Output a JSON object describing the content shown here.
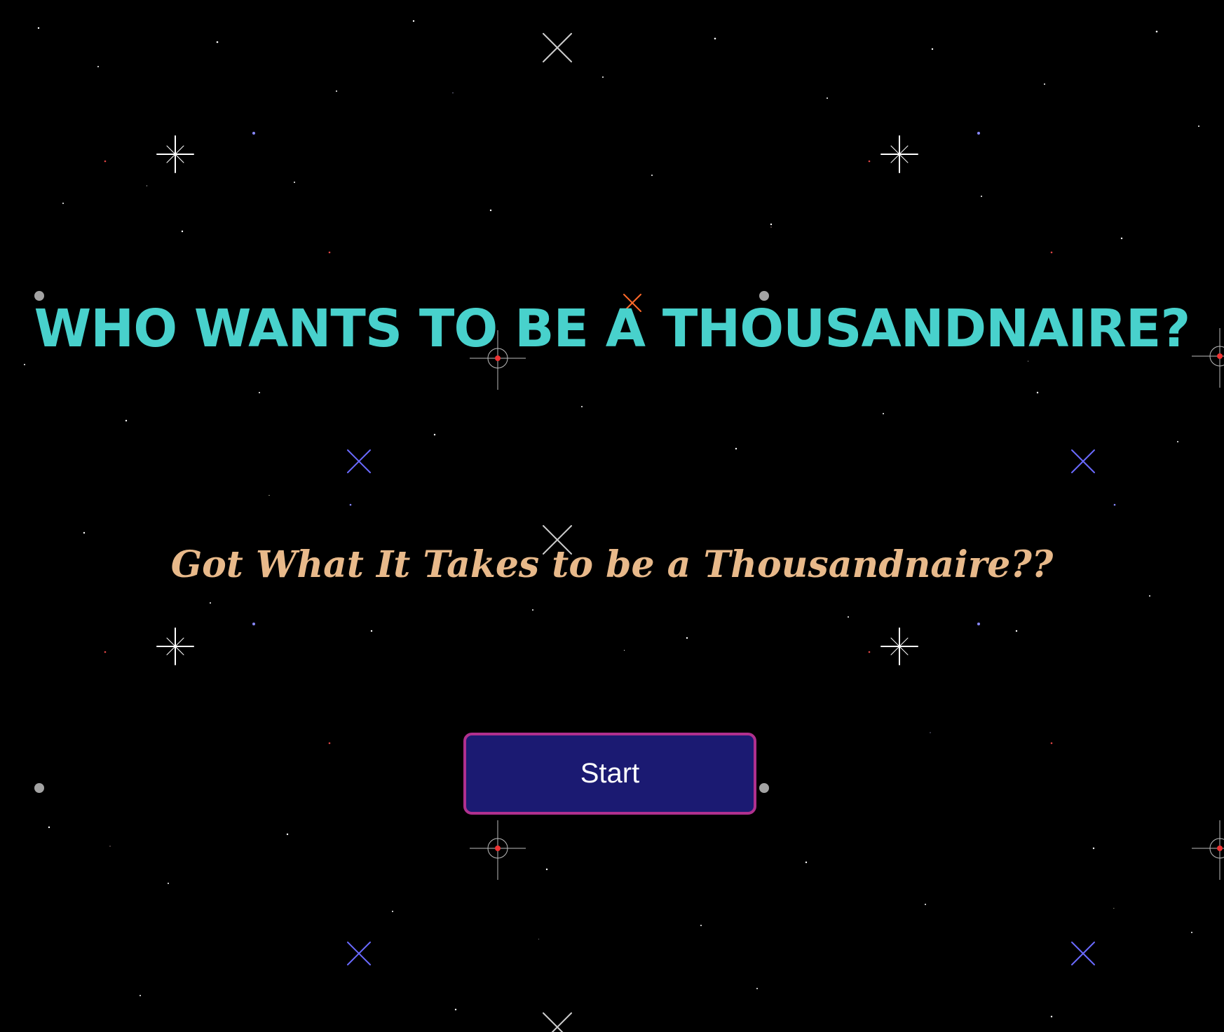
{
  "title": "WHO WANTS TO BE A THOUSANDNAIRE?",
  "subtitle": "Got What It Takes to be a Thousandnaire??",
  "start_button": {
    "label": "Start"
  },
  "colors": {
    "title": "#48d1cc",
    "subtitle": "#e8b98a",
    "button_bg": "#1b1a72",
    "button_border": "#b0308e",
    "background": "#000000"
  },
  "background_icon": "starfield-icon"
}
